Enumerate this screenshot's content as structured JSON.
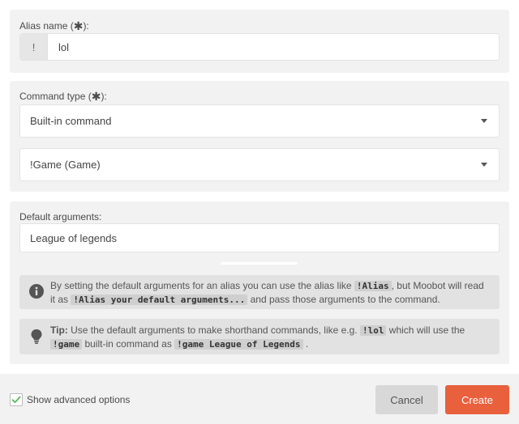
{
  "alias": {
    "label": "Alias name (",
    "label_suffix": "):",
    "required_mark": "✱",
    "prefix": "!",
    "value": "lol"
  },
  "command": {
    "label": "Command type (",
    "label_suffix": "):",
    "required_mark": "✱",
    "type_value": "Built-in command",
    "command_value": "!Game (Game)"
  },
  "defaults": {
    "label": "Default arguments:",
    "value": "League of legends"
  },
  "info": {
    "part1": "By setting the default arguments for an alias you can use the alias like ",
    "code1": "!Alias",
    "part2": ", but Moobot will read it as ",
    "code2": "!Alias your default arguments...",
    "part3": " and pass those arguments to the command."
  },
  "tip": {
    "label": "Tip:",
    "part1": " Use the default arguments to make shorthand commands, like e.g. ",
    "code1": "!lol",
    "part2": " which will use the ",
    "code2": "!game",
    "part3": " built-in command as ",
    "code3": "!game League of Legends",
    "part4": " ."
  },
  "footer": {
    "advanced_label": "Show advanced options",
    "advanced_checked": true,
    "cancel_label": "Cancel",
    "create_label": "Create"
  },
  "colors": {
    "accent": "#e8603c",
    "check": "#5cb85c"
  }
}
